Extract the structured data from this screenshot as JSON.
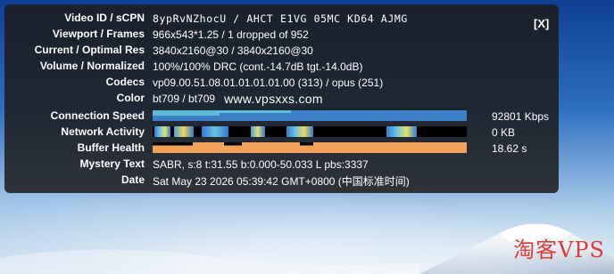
{
  "overlay": {
    "close_label": "[X]",
    "rows": {
      "video_id": {
        "label": "Video ID / sCPN",
        "value": "8ypRvNZhocU / AHCT E1VG 05MC KD64 AJMG"
      },
      "viewport": {
        "label": "Viewport / Frames",
        "value": "966x543*1.25 / 1 dropped of 952"
      },
      "resolution": {
        "label": "Current / Optimal Res",
        "value": "3840x2160@30 / 3840x2160@30"
      },
      "volume": {
        "label": "Volume / Normalized",
        "value": "100%/100% DRC (cont.-14.7dB tgt.-14.0dB)"
      },
      "codecs": {
        "label": "Codecs",
        "value": "vp09.00.51.08.01.01.01.01.00 (313) / opus (251)"
      },
      "color": {
        "label": "Color",
        "value": "bt709 / bt709",
        "site": "www.vpsxxs.com"
      },
      "connection": {
        "label": "Connection Speed",
        "value": "92801 Kbps"
      },
      "network": {
        "label": "Network Activity",
        "value": "0 KB"
      },
      "buffer": {
        "label": "Buffer Health",
        "value": "18.62 s"
      },
      "mystery": {
        "label": "Mystery Text",
        "value": "SABR, s:8 t:31.55 b:0.000-50.033 L pbs:3337"
      },
      "date": {
        "label": "Date",
        "value": "Sat May 23 2026 05:39:42 GMT+0800 (中国标准时间)"
      }
    }
  },
  "watermark": "淘客VPS",
  "colors": {
    "connection_bar": "#3d7fc6",
    "connection_bar_light": "#62b8d8",
    "buffer_bar": "#f2a25a",
    "network_bar": "#000000"
  }
}
